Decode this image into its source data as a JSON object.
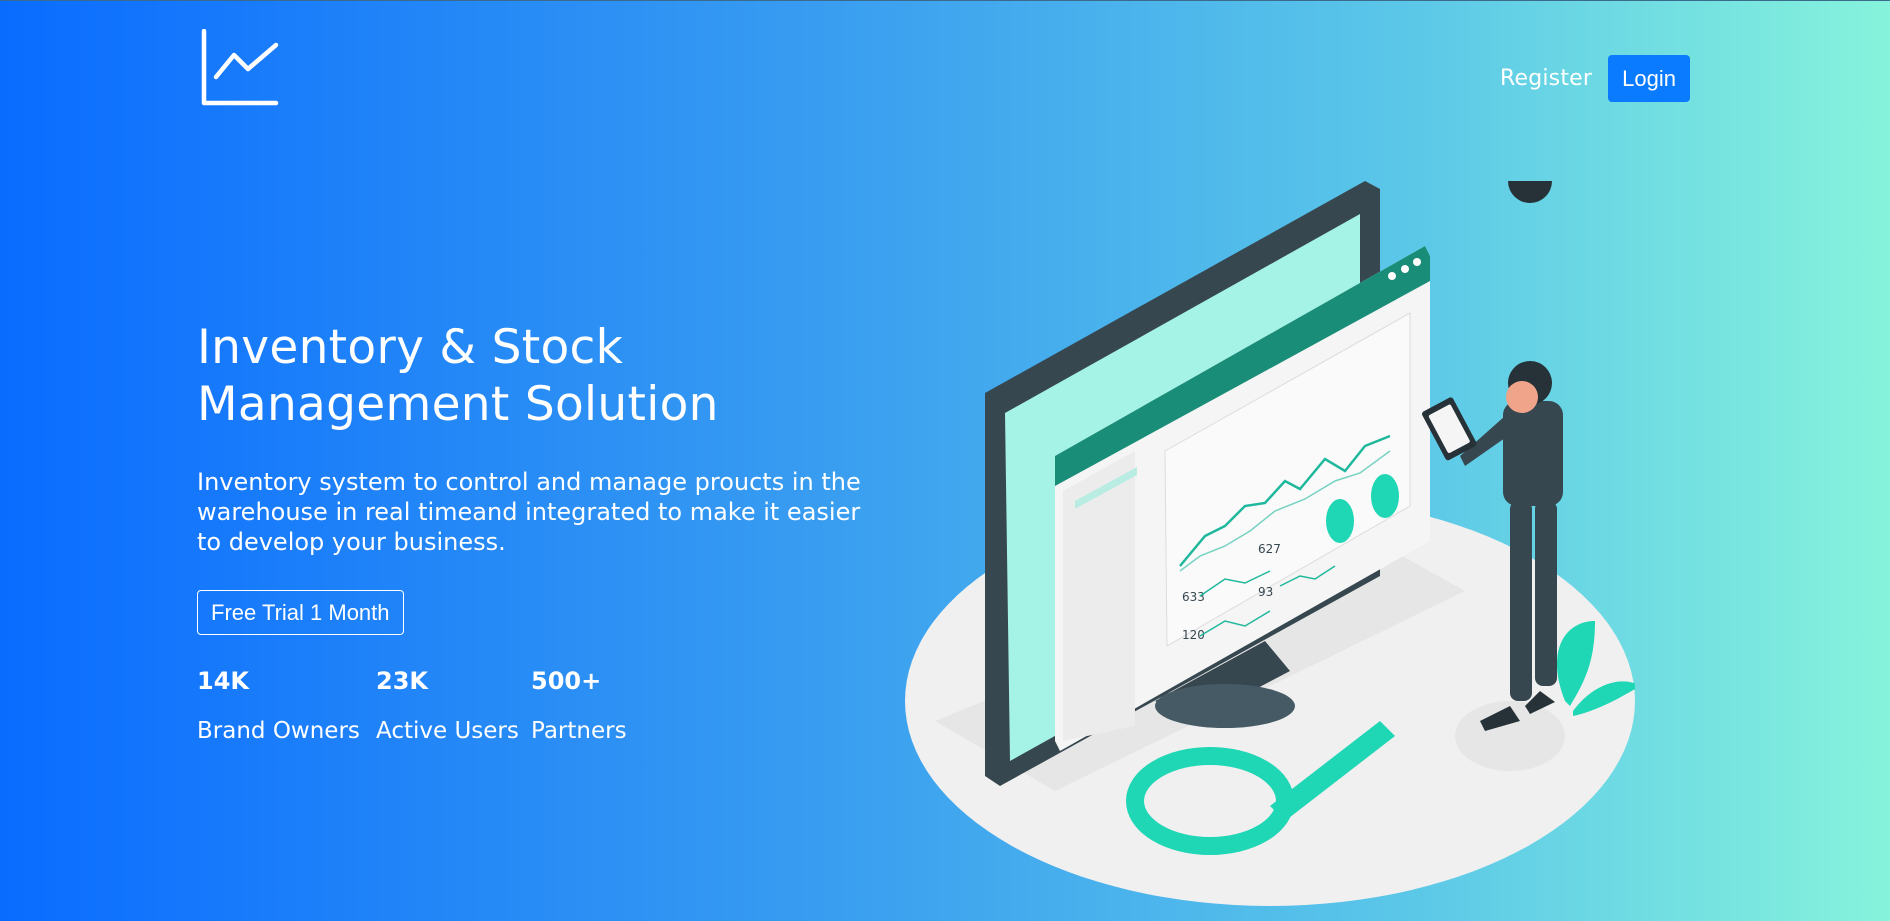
{
  "header": {
    "logo_icon": "line-chart-icon",
    "nav": {
      "register_label": "Register",
      "login_label": "Login"
    }
  },
  "hero": {
    "title_line1": "Inventory & Stock",
    "title_line2": "Management Solution",
    "description": "Inventory system to control and manage proucts in the warehouse in real timeand integrated to make it easier to develop your business.",
    "cta_label": "Free Trial 1 Month"
  },
  "stats": [
    {
      "value": "14K",
      "label": "Brand Owners"
    },
    {
      "value": "23K",
      "label": "Active Users"
    },
    {
      "value": "500+",
      "label": "Partners"
    }
  ],
  "illustration": {
    "icon": "dashboard-illustration",
    "dashboard_numbers": [
      "627",
      "633",
      "93",
      "120"
    ]
  },
  "colors": {
    "gradient_start": "#0a6cff",
    "gradient_end": "#86f3dc",
    "login_button": "#0a7bff",
    "accent_teal": "#1fd6b5"
  }
}
